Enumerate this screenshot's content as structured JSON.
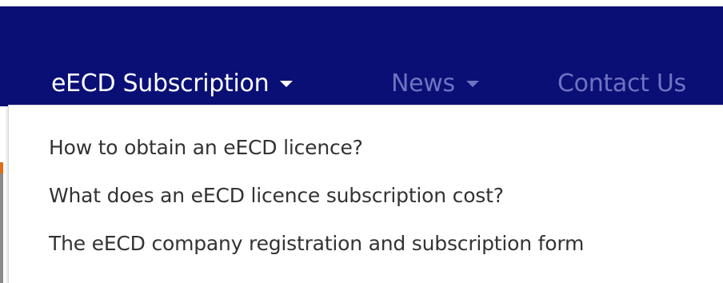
{
  "nav": {
    "items": [
      {
        "label": "eECD Subscription",
        "has_caret": true,
        "active": true
      },
      {
        "label": "News",
        "has_caret": true,
        "active": false
      },
      {
        "label": "Contact Us",
        "has_caret": false,
        "active": false
      }
    ]
  },
  "dropdown": {
    "items": [
      {
        "label": "How to obtain an eECD licence?"
      },
      {
        "label": "What does an eECD licence subscription cost?"
      },
      {
        "label": "The eECD company registration and subscription form"
      }
    ]
  },
  "colors": {
    "navbar_bg": "#0a0f76",
    "active_text": "#ffffff",
    "inactive_text": "#6f73c0",
    "dropdown_text": "#333333",
    "accent_orange": "#e26b18"
  },
  "icons": {
    "caret": "caret-down-icon"
  }
}
